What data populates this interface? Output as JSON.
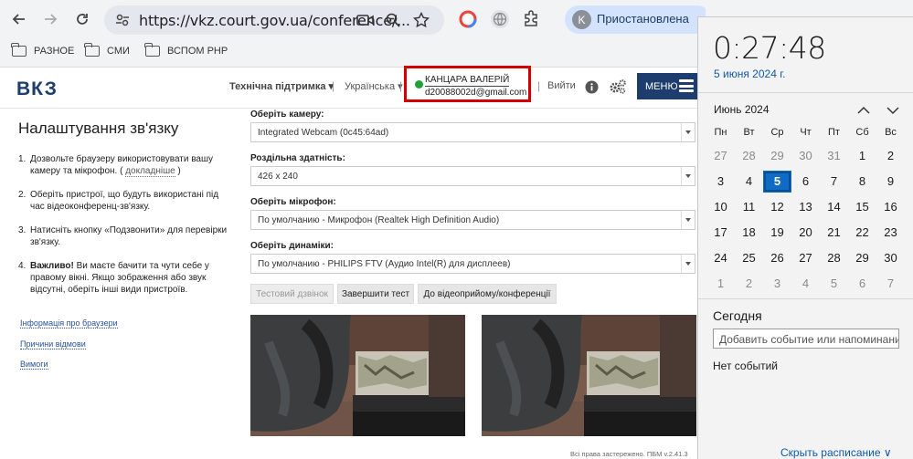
{
  "browser": {
    "url": "https://vkz.court.gov.ua/conference/...",
    "profile_initial": "K",
    "profile_status": "Приостановлена",
    "bookmarks": [
      {
        "label": "РАЗНОЕ"
      },
      {
        "label": "СМИ"
      },
      {
        "label": "ВСПОМ РНР"
      }
    ]
  },
  "header": {
    "logo": "ВКЗ",
    "support": "Технічна підтримка ▾",
    "language": "Українська ▾",
    "user_name": "КАНЦАРА ВАЛЕРІЙ",
    "user_email": "d20088002d@gmail.com",
    "logout": "Вийти",
    "menu": "МЕНЮ",
    "separator": "|"
  },
  "left": {
    "title": "Налаштування зв'язку",
    "steps": [
      {
        "num": "1.",
        "text": "Дозвольте браузеру використовувати вашу камеру та мікрофон. ( ",
        "link": "докладніше",
        "tail": " )"
      },
      {
        "num": "2.",
        "text": "Оберіть пристрої, що будуть використані під час відеоконференц-зв'язку."
      },
      {
        "num": "3.",
        "text": "Натисніть кнопку «Подзвонити» для перевірки зв'язку."
      },
      {
        "num": "4.",
        "bold": "Важливо!",
        "text": " Ви маєте бачити та чути себе у правому вікні. Якщо зображення або звук відсутні, оберіть інші види пристроїв."
      }
    ],
    "links": [
      "Інформація про браузери",
      "Причини відмови",
      "Вимоги"
    ]
  },
  "form": {
    "camera_label": "Оберіть камеру:",
    "camera_value": "Integrated Webcam (0c45:64ad)",
    "resolution_label": "Роздільна здатність:",
    "resolution_value": "426 x 240",
    "mic_label": "Оберіть мікрофон:",
    "mic_value": "По умолчанию - Микрофон (Realtek High Definition Audio)",
    "speakers_label": "Оберіть динаміки:",
    "speakers_value": "По умолчанию - PHILIPS FTV (Аудио Intel(R) для дисплеев)",
    "btn_test_call": "Тестовий дзвінок",
    "btn_finish_test": "Завершити тест",
    "btn_to_reception": "До відеоприйому/конференції"
  },
  "footer": "Всі права застережено. ПБМ v.2.41.3",
  "calendar": {
    "time": "0:27:48",
    "date": "5 июня 2024 г.",
    "month": "Июнь 2024",
    "weekdays": [
      "Пн",
      "Вт",
      "Ср",
      "Чт",
      "Пт",
      "Сб",
      "Вс"
    ],
    "weeks": [
      [
        "27",
        "28",
        "29",
        "30",
        "31",
        "1",
        "2"
      ],
      [
        "3",
        "4",
        "5",
        "6",
        "7",
        "8",
        "9"
      ],
      [
        "10",
        "11",
        "12",
        "13",
        "14",
        "15",
        "16"
      ],
      [
        "17",
        "18",
        "19",
        "20",
        "21",
        "22",
        "23"
      ],
      [
        "24",
        "25",
        "26",
        "27",
        "28",
        "29",
        "30"
      ],
      [
        "1",
        "2",
        "3",
        "4",
        "5",
        "6",
        "7"
      ]
    ],
    "today_label": "Сегодня",
    "event_placeholder": "Добавить событие или напоминание",
    "no_events": "Нет событий",
    "hide_schedule": "Скрыть расписание ∨",
    "accent": "#0f6bc4"
  }
}
